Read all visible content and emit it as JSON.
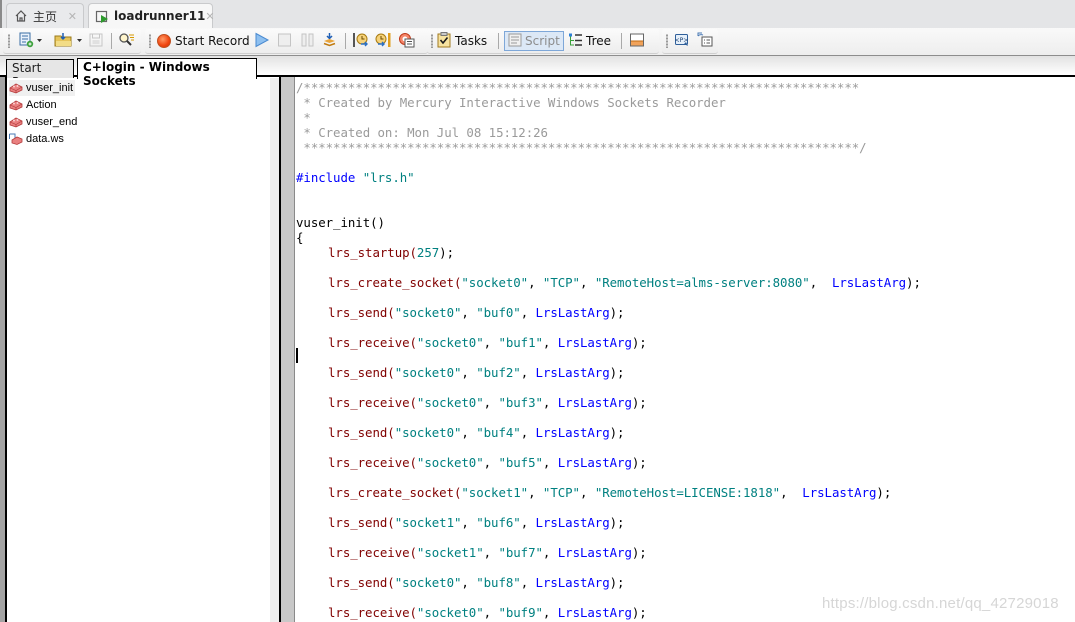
{
  "browser_tabs": [
    {
      "label": "主页",
      "icon": "home-icon",
      "active": false
    },
    {
      "label": "loadrunner11",
      "icon": "loadrunner-icon",
      "active": true
    }
  ],
  "toolbar": {
    "new_script": "new-script-icon",
    "open_script": "open-icon",
    "save": "save-icon",
    "find": "find-icon",
    "start_record_label": "Start Record",
    "run": "play-icon",
    "stop": "stop-icon",
    "pause": "pause-icon",
    "compile": "compile-icon",
    "tasks_label": "Tasks",
    "script_label": "Script",
    "tree_label": "Tree"
  },
  "doc_tabs": [
    {
      "label": "Start Page",
      "active": false
    },
    {
      "label": "C+login - Windows Sockets",
      "active": true
    }
  ],
  "tree": {
    "items": [
      {
        "label": "vuser_init",
        "icon": "action-icon",
        "selected": true
      },
      {
        "label": "Action",
        "icon": "action-icon",
        "selected": false
      },
      {
        "label": "vuser_end",
        "icon": "action-icon",
        "selected": false
      },
      {
        "label": "data.ws",
        "icon": "data-file-icon",
        "selected": false
      }
    ]
  },
  "editor": {
    "comment": [
      "/***************************************************************************",
      " * Created by Mercury Interactive Windows Sockets Recorder",
      " *",
      " * Created on: Mon Jul 08 15:12:26",
      " ***************************************************************************/"
    ],
    "include_directive": "#include",
    "include_file": "\"lrs.h\"",
    "function_name": "vuser_init()",
    "open_brace": "{",
    "statements": [
      {
        "fn": "lrs_startup(",
        "args": [
          {
            "t": "num",
            "v": "257"
          }
        ],
        "end": ");"
      },
      {
        "fn": "lrs_create_socket(",
        "args": [
          {
            "t": "str",
            "v": "\"socket0\""
          },
          {
            "t": "str",
            "v": "\"TCP\""
          },
          {
            "t": "str",
            "v": "\"RemoteHost=alms-server:8080\""
          },
          {
            "t": "kw",
            "v": " LrsLastArg"
          }
        ],
        "end": ");"
      },
      {
        "fn": "lrs_send(",
        "args": [
          {
            "t": "str",
            "v": "\"socket0\""
          },
          {
            "t": "str",
            "v": "\"buf0\""
          },
          {
            "t": "kw",
            "v": "LrsLastArg"
          }
        ],
        "end": ");"
      },
      {
        "fn": "lrs_receive(",
        "args": [
          {
            "t": "str",
            "v": "\"socket0\""
          },
          {
            "t": "str",
            "v": "\"buf1\""
          },
          {
            "t": "kw",
            "v": "LrsLastArg"
          }
        ],
        "end": ");"
      },
      {
        "fn": "lrs_send(",
        "args": [
          {
            "t": "str",
            "v": "\"socket0\""
          },
          {
            "t": "str",
            "v": "\"buf2\""
          },
          {
            "t": "kw",
            "v": "LrsLastArg"
          }
        ],
        "end": ");"
      },
      {
        "fn": "lrs_receive(",
        "args": [
          {
            "t": "str",
            "v": "\"socket0\""
          },
          {
            "t": "str",
            "v": "\"buf3\""
          },
          {
            "t": "kw",
            "v": "LrsLastArg"
          }
        ],
        "end": ");"
      },
      {
        "fn": "lrs_send(",
        "args": [
          {
            "t": "str",
            "v": "\"socket0\""
          },
          {
            "t": "str",
            "v": "\"buf4\""
          },
          {
            "t": "kw",
            "v": "LrsLastArg"
          }
        ],
        "end": ");"
      },
      {
        "fn": "lrs_receive(",
        "args": [
          {
            "t": "str",
            "v": "\"socket0\""
          },
          {
            "t": "str",
            "v": "\"buf5\""
          },
          {
            "t": "kw",
            "v": "LrsLastArg"
          }
        ],
        "end": ");"
      },
      {
        "fn": "lrs_create_socket(",
        "args": [
          {
            "t": "str",
            "v": "\"socket1\""
          },
          {
            "t": "str",
            "v": "\"TCP\""
          },
          {
            "t": "str",
            "v": "\"RemoteHost=LICENSE:1818\""
          },
          {
            "t": "kw",
            "v": " LrsLastArg"
          }
        ],
        "end": ");"
      },
      {
        "fn": "lrs_send(",
        "args": [
          {
            "t": "str",
            "v": "\"socket1\""
          },
          {
            "t": "str",
            "v": "\"buf6\""
          },
          {
            "t": "kw",
            "v": "LrsLastArg"
          }
        ],
        "end": ");"
      },
      {
        "fn": "lrs_receive(",
        "args": [
          {
            "t": "str",
            "v": "\"socket1\""
          },
          {
            "t": "str",
            "v": "\"buf7\""
          },
          {
            "t": "kw",
            "v": "LrsLastArg"
          }
        ],
        "end": ");"
      },
      {
        "fn": "lrs_send(",
        "args": [
          {
            "t": "str",
            "v": "\"socket0\""
          },
          {
            "t": "str",
            "v": "\"buf8\""
          },
          {
            "t": "kw",
            "v": "LrsLastArg"
          }
        ],
        "end": ");"
      },
      {
        "fn": "lrs_receive(",
        "args": [
          {
            "t": "str",
            "v": "\"socket0\""
          },
          {
            "t": "str",
            "v": "\"buf9\""
          },
          {
            "t": "kw",
            "v": "LrsLastArg"
          }
        ],
        "end": ");"
      }
    ],
    "colors": {
      "comment": "#9a9a9a",
      "preprocessor": "#0000ff",
      "function": "#800000",
      "string": "#008080",
      "keyword": "#0000ff"
    }
  },
  "watermark": "https://blog.csdn.net/qq_42729018"
}
